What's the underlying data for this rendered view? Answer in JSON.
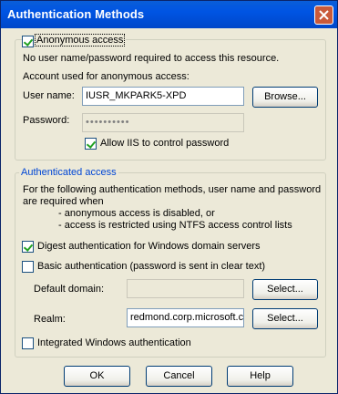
{
  "window": {
    "title": "Authentication Methods"
  },
  "anonymous": {
    "checkbox_label": "Anonymous access",
    "checked": true,
    "description": "No user name/password required to access this resource.",
    "account_label": "Account used for anonymous access:",
    "username_label": "User name:",
    "username_value": "IUSR_MKPARK5-XPD",
    "browse_label": "Browse...",
    "password_label": "Password:",
    "password_value": "••••••••••",
    "allow_iis_label": "Allow IIS to control password",
    "allow_iis_checked": true
  },
  "authenticated": {
    "group_title": "Authenticated access",
    "description_line1": "For the following authentication methods, user name and password",
    "description_line2": "are required when",
    "bullet1": "- anonymous access is disabled, or",
    "bullet2": "- access is restricted using NTFS access control lists",
    "digest_label": "Digest authentication for Windows domain servers",
    "digest_checked": true,
    "basic_label": "Basic authentication (password is sent in clear text)",
    "basic_checked": false,
    "default_domain_label": "Default domain:",
    "default_domain_value": "",
    "select_label": "Select...",
    "realm_label": "Realm:",
    "realm_value": "redmond.corp.microsoft.com",
    "integrated_label": "Integrated Windows authentication",
    "integrated_checked": false
  },
  "buttons": {
    "ok": "OK",
    "cancel": "Cancel",
    "help": "Help"
  }
}
